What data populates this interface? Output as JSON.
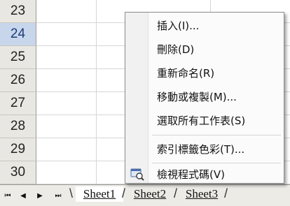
{
  "rows": [
    "23",
    "24",
    "25",
    "26",
    "27",
    "28",
    "29",
    "30"
  ],
  "selected_row": "24",
  "tabs": [
    {
      "label": "Sheet1",
      "active": true
    },
    {
      "label": "Sheet2",
      "active": false
    },
    {
      "label": "Sheet3",
      "active": false
    }
  ],
  "nav": {
    "first": "⏮",
    "prev": "◀",
    "next": "▶",
    "last": "⏭"
  },
  "context_menu": {
    "insert": "插入(I)...",
    "delete": "刪除(D)",
    "rename": "重新命名(R)",
    "move_copy": "移動或複製(M)...",
    "select_all": "選取所有工作表(S)",
    "tab_color": "索引標籤色彩(T)...",
    "view_code": "檢視程式碼(V)"
  },
  "icons": {
    "view_code": "view-code-icon"
  }
}
